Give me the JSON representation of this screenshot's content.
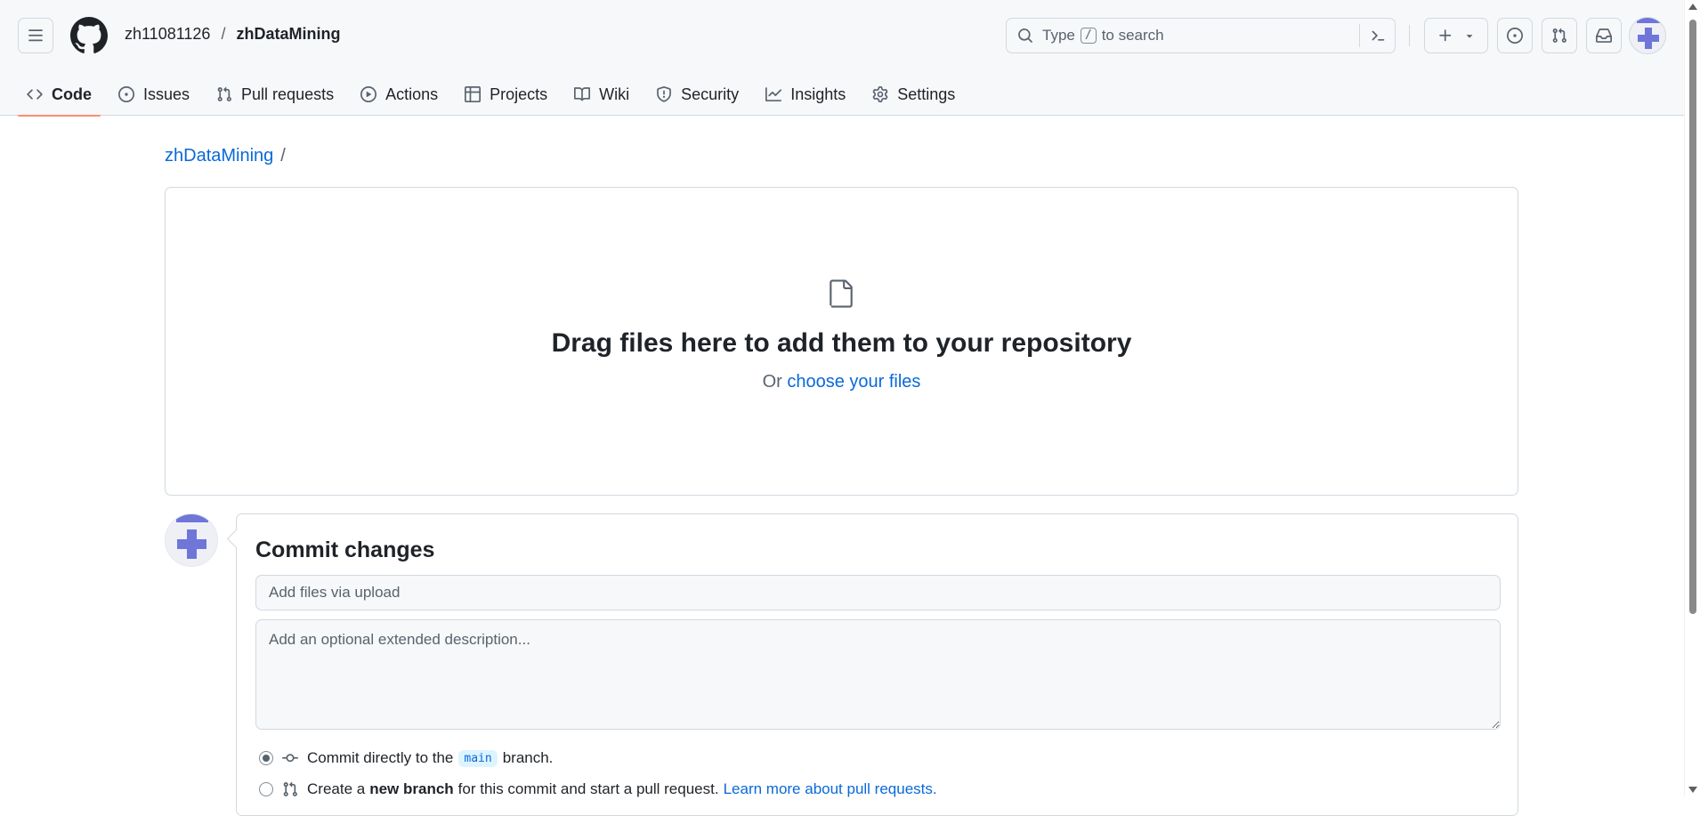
{
  "header": {
    "owner": "zh11081126",
    "separator": "/",
    "repo": "zhDataMining",
    "search": {
      "prefix": "Type",
      "key": "/",
      "suffix": "to search"
    },
    "icons": {
      "menu": "hamburger-icon",
      "logo": "github-mark-icon",
      "search": "search-icon",
      "command": "command-palette-icon",
      "create": "plus-icon",
      "dropdown": "triangle-down-icon",
      "issues": "issue-opened-icon",
      "pulls": "git-pull-request-icon",
      "inbox": "inbox-icon"
    }
  },
  "nav": {
    "tabs": [
      {
        "label": "Code",
        "icon": "code-icon",
        "active": true
      },
      {
        "label": "Issues",
        "icon": "issue-opened-icon"
      },
      {
        "label": "Pull requests",
        "icon": "git-pull-request-icon"
      },
      {
        "label": "Actions",
        "icon": "play-icon"
      },
      {
        "label": "Projects",
        "icon": "table-icon"
      },
      {
        "label": "Wiki",
        "icon": "book-icon"
      },
      {
        "label": "Security",
        "icon": "shield-icon"
      },
      {
        "label": "Insights",
        "icon": "graph-icon"
      },
      {
        "label": "Settings",
        "icon": "gear-icon"
      }
    ]
  },
  "main": {
    "breadcrumb_repo": "zhDataMining",
    "breadcrumb_sep": "/",
    "dropzone": {
      "title": "Drag files here to add them to your repository",
      "or": "Or",
      "choose": "choose your files"
    },
    "commit": {
      "title": "Commit changes",
      "summary_placeholder": "Add files via upload",
      "summary_value": "",
      "description_placeholder": "Add an optional extended description...",
      "option_direct": {
        "before": "Commit directly to the",
        "branch": "main",
        "after": "branch."
      },
      "option_new": {
        "before": "Create a",
        "bold": "new branch",
        "after": "for this commit and start a pull request.",
        "link": "Learn more about pull requests."
      }
    }
  },
  "colors": {
    "accent": "#0969da",
    "active_tab_underline": "#fd8c73",
    "avatar": "#6e76d8",
    "header_bg": "#f6f8fa",
    "border": "#d1d9e0"
  }
}
